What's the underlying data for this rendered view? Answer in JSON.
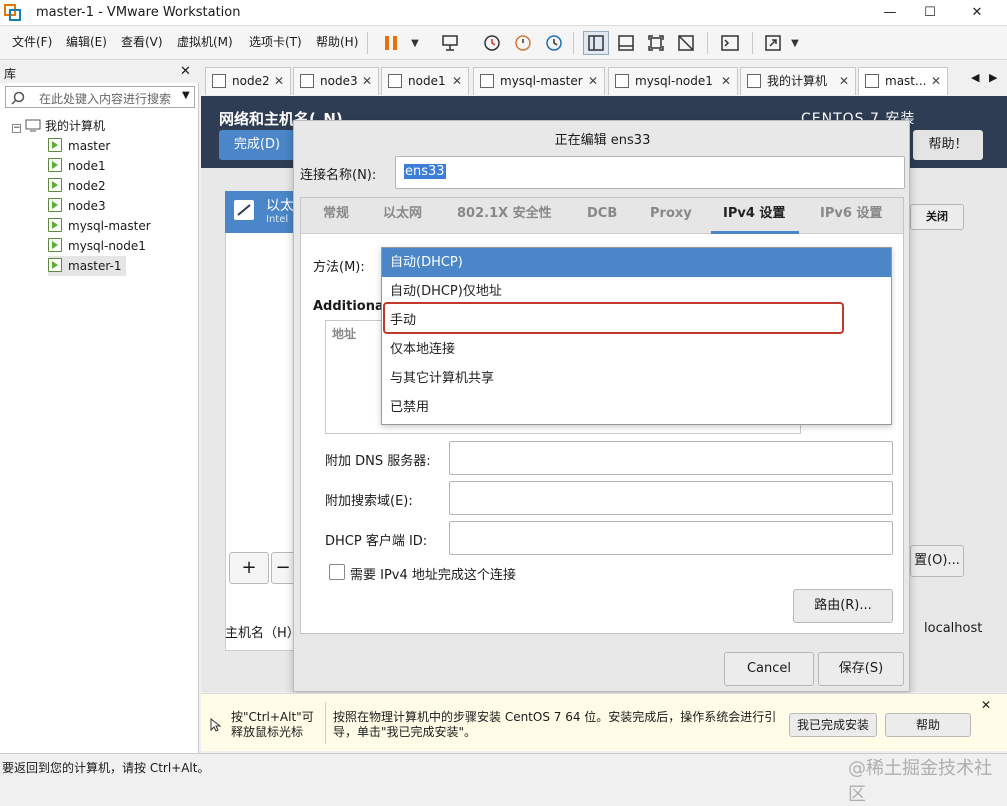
{
  "window": {
    "title": "master-1 - VMware Workstation",
    "min": "—",
    "max": "☐",
    "close": "✕"
  },
  "menu": [
    "文件(F)",
    "编辑(E)",
    "查看(V)",
    "虚拟机(M)",
    "选项卡(T)",
    "帮助(H)"
  ],
  "library": {
    "title": "库",
    "close": "✕",
    "search_placeholder": "在此处键入内容进行搜索",
    "root": "我的计算机",
    "items": [
      "master",
      "node1",
      "node2",
      "node3",
      "mysql-master",
      "mysql-node1",
      "master-1"
    ]
  },
  "tabs": [
    "node2",
    "node3",
    "node1",
    "mysql-master",
    "mysql-node1",
    "我的计算机",
    "mast..."
  ],
  "installer": {
    "header": "网络和主机名(_N)",
    "done": "完成(D)",
    "centos": "CENTOS 7 安装",
    "help": "帮助！",
    "close_label": "关闭",
    "eth_label": "以太",
    "eth_sub": "Intel",
    "add": "+",
    "remove": "−",
    "configure": "置(O)...",
    "hostname_label": "主机名（H）",
    "hostname_value": "localhost"
  },
  "dialog": {
    "title": "正在编辑 ens33",
    "conn_name_label": "连接名称(N):",
    "conn_name_value": "ens33",
    "tabs": [
      "常规",
      "以太网",
      "802.1X 安全性",
      "DCB",
      "Proxy",
      "IPv4 设置",
      "IPv6 设置"
    ],
    "active_tab": "IPv4 设置",
    "method_label": "方法(M):",
    "additional": "Additiona",
    "addr_header": "地址",
    "methods": [
      "自动(DHCP)",
      "自动(DHCP)仅地址",
      "手动",
      "仅本地连接",
      "与其它计算机共享",
      "已禁用"
    ],
    "dns_label": "附加 DNS 服务器:",
    "search_label": "附加搜索域(E):",
    "dhcp_label": "DHCP 客户端 ID:",
    "require_label": "需要 IPv4 地址完成这个连接",
    "routes": "路由(R)...",
    "cancel": "Cancel",
    "save": "保存(S)"
  },
  "hint": {
    "left": "按\"Ctrl+Alt\"可释放鼠标光标",
    "main": "按照在物理计算机中的步骤安装 CentOS 7 64 位。安装完成后，操作系统会进行引导，单击\"我已完成安装\"。",
    "done": "我已完成安装",
    "help": "帮助"
  },
  "status": "要返回到您的计算机，请按 Ctrl+Alt。",
  "watermark": "@稀土掘金技术社区",
  "colors": {
    "accent": "#4a86c8",
    "highlight": "#c0392b",
    "header": "#2e3d53"
  }
}
